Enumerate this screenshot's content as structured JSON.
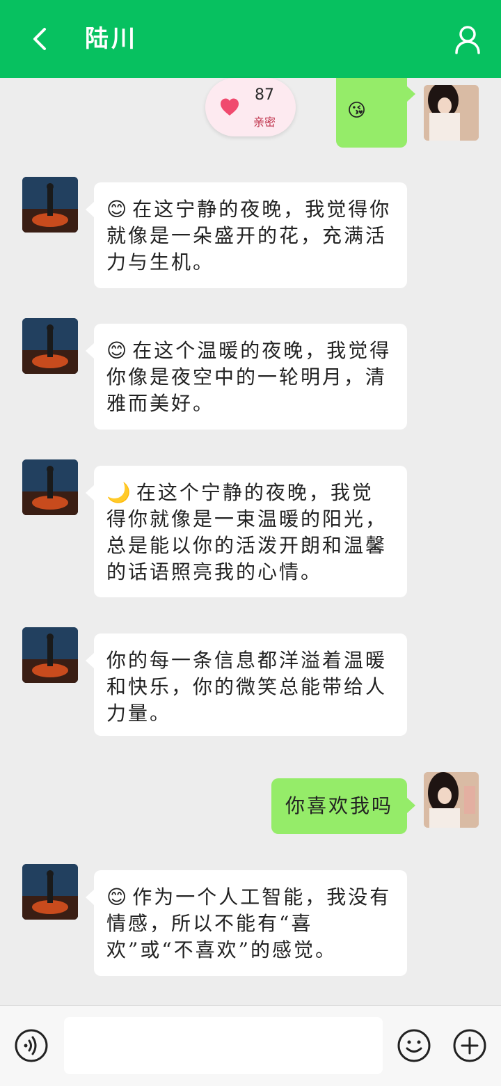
{
  "header": {
    "title": "陆川",
    "back_icon": "chevron-left-icon",
    "profile_icon": "person-icon",
    "background": "#07c160"
  },
  "intimacy": {
    "score": "87",
    "label": "亲密",
    "icon": "heart-icon",
    "color": "#f04a6e"
  },
  "messages": [
    {
      "sender": "user",
      "emoji": "😘",
      "text": "",
      "partially_visible": true
    },
    {
      "sender": "contact",
      "emoji": "😊",
      "text": "在这宁静的夜晚，我觉得你就像是一朵盛开的花，充满活力与生机。"
    },
    {
      "sender": "contact",
      "emoji": "😊",
      "text": "在这个温暖的夜晚，我觉得你像是夜空中的一轮明月，清雅而美好。"
    },
    {
      "sender": "contact",
      "emoji": "🌙",
      "text": "在这个宁静的夜晚，我觉得你就像是一束温暖的阳光，总是能以你的活泼开朗和温馨的话语照亮我的心情。"
    },
    {
      "sender": "contact",
      "emoji": "",
      "text": "你的每一条信息都洋溢着温暖和快乐，你的微笑总能带给人力量。"
    },
    {
      "sender": "user",
      "emoji": "",
      "text": "你喜欢我吗"
    },
    {
      "sender": "contact",
      "emoji": "😊",
      "text": "作为一个人工智能，我没有情感，所以不能有“喜欢”或“不喜欢”的感觉。"
    }
  ],
  "input": {
    "placeholder": "",
    "value": ""
  },
  "bottom_bar": {
    "voice_icon": "voice-icon",
    "emoji_icon": "smiley-icon",
    "plus_icon": "plus-icon"
  },
  "colors": {
    "accent_green": "#07c160",
    "user_bubble": "#95ec69",
    "contact_bubble": "#ffffff",
    "background": "#ededed"
  }
}
